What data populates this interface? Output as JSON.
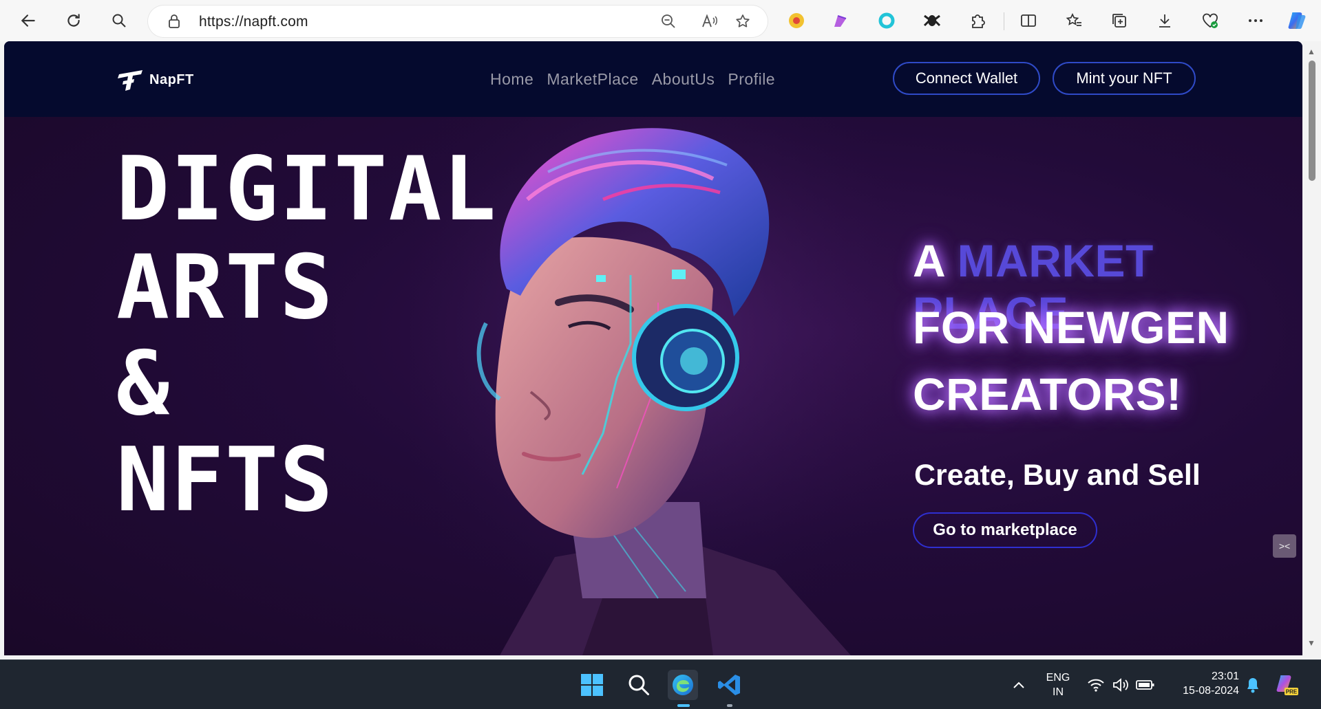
{
  "browser": {
    "url": "https://napft.com"
  },
  "site": {
    "logo_text": "NapFT",
    "nav": [
      {
        "label": "Home"
      },
      {
        "label": "MarketPlace"
      },
      {
        "label": "AboutUs"
      },
      {
        "label": "Profile"
      }
    ],
    "connect_wallet": "Connect Wallet",
    "mint_nft": "Mint your NFT"
  },
  "hero": {
    "big_lines": [
      "DIGITAL",
      "ARTS",
      "&",
      "NFTS"
    ],
    "headline_a": "A",
    "headline_accent": "MARKET PLACE",
    "headline_line2": "FOR NEWGEN",
    "headline_line3": "CREATORS!",
    "tagline": "Create, Buy and Sell",
    "cta": "Go to marketplace",
    "side_tab_glyph": "><"
  },
  "taskbar": {
    "language_top": "ENG",
    "language_bottom": "IN",
    "time": "23:01",
    "date": "15-08-2024",
    "copilot_badge": "PRE"
  }
}
